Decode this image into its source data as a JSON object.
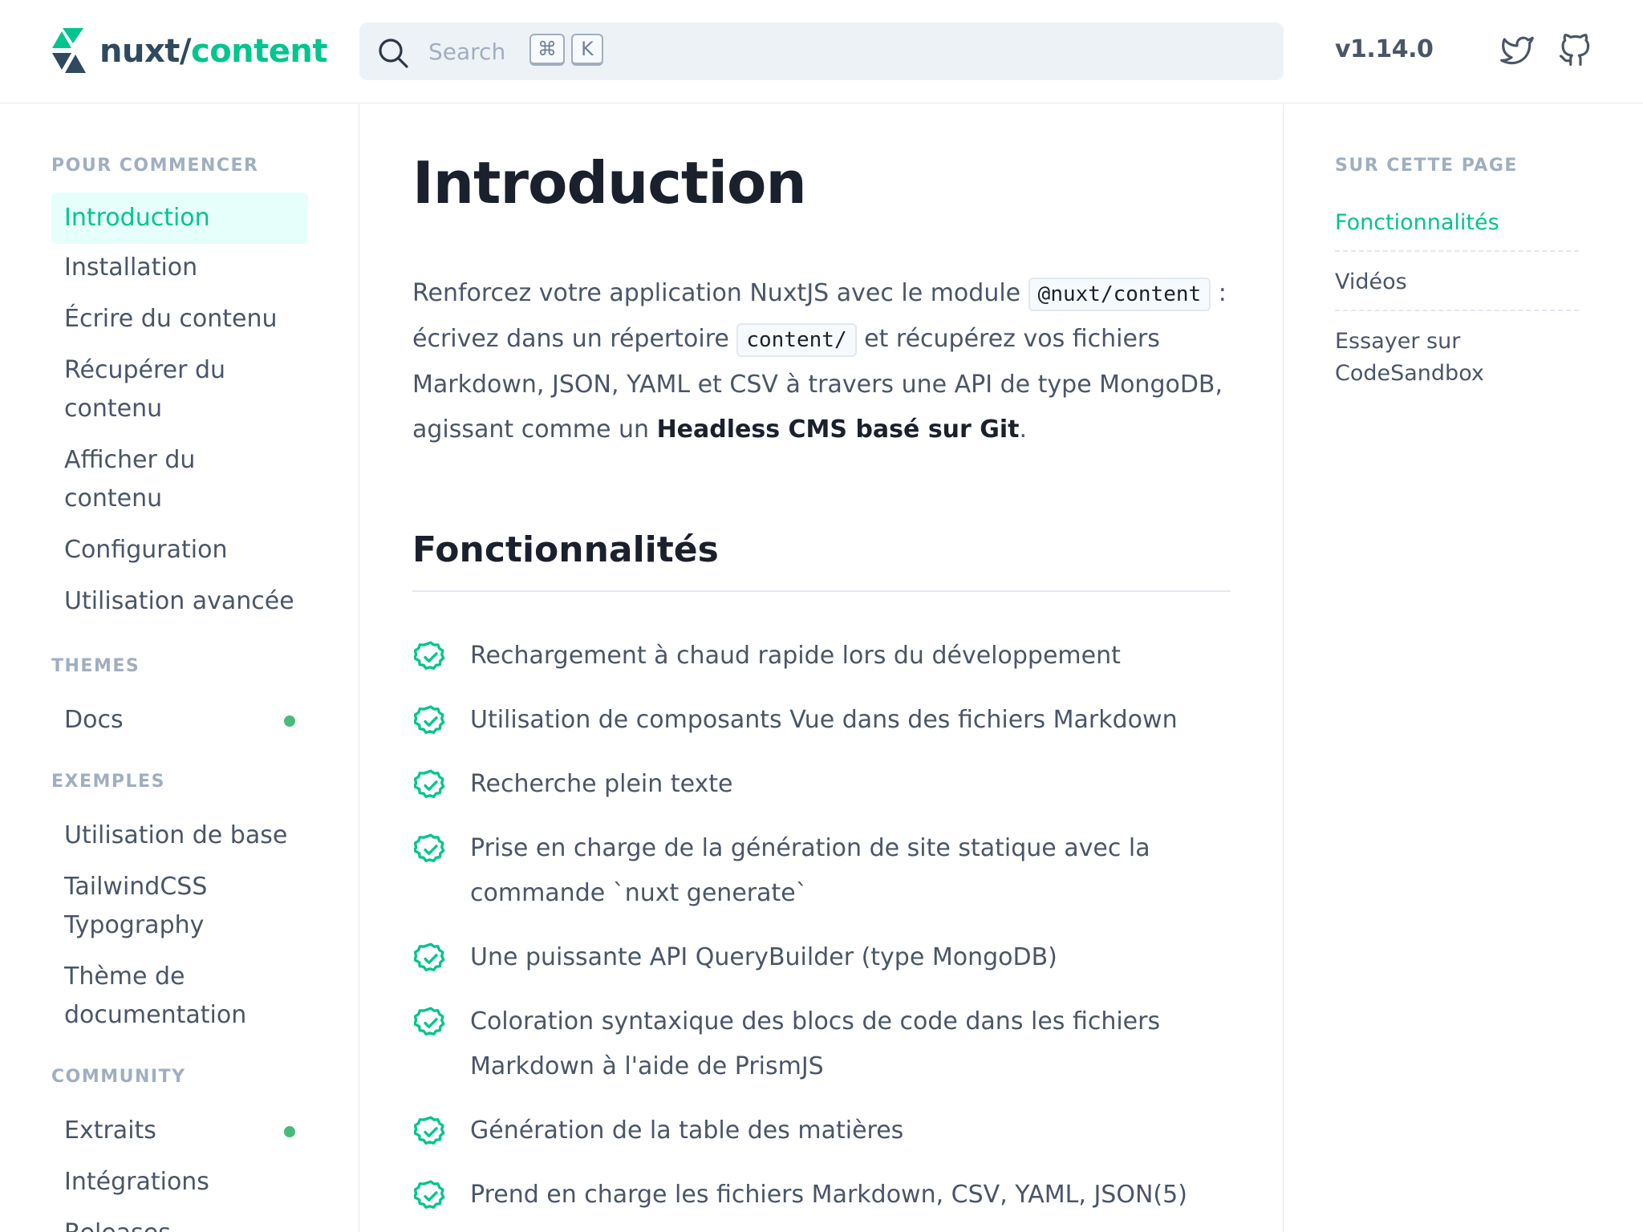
{
  "header": {
    "logo": {
      "part1": "nuxt/",
      "part2": "content"
    },
    "search": {
      "placeholder": "Search",
      "shortcut_keys": [
        "⌘",
        "K"
      ]
    },
    "version": "v1.14.0",
    "icons": [
      "twitter-icon",
      "github-icon"
    ]
  },
  "sidebar": {
    "sections": [
      {
        "title": "POUR COMMENCER",
        "items": [
          {
            "label": "Introduction",
            "active": true
          },
          {
            "label": "Installation"
          },
          {
            "label": "Écrire du contenu"
          },
          {
            "label": "Récupérer du contenu"
          },
          {
            "label": "Afficher du contenu"
          },
          {
            "label": "Configuration"
          },
          {
            "label": "Utilisation avancée"
          }
        ]
      },
      {
        "title": "THEMES",
        "items": [
          {
            "label": "Docs",
            "new_badge": true
          }
        ]
      },
      {
        "title": "EXEMPLES",
        "items": [
          {
            "label": "Utilisation de base"
          },
          {
            "label": "TailwindCSS Typography"
          },
          {
            "label": "Thème de documentation"
          }
        ]
      },
      {
        "title": "COMMUNITY",
        "items": [
          {
            "label": "Extraits",
            "new_badge": true
          },
          {
            "label": "Intégrations"
          },
          {
            "label": "Releases"
          }
        ]
      }
    ]
  },
  "main": {
    "title": "Introduction",
    "intro": {
      "text1": "Renforcez votre application NuxtJS avec le module ",
      "code1": "@nuxt/content",
      "text2": " : écrivez dans un répertoire ",
      "code2": "content/",
      "text3": " et récupérez vos fichiers Markdown, JSON, YAML et CSV à travers une API de type MongoDB, agissant comme un ",
      "strong": "Headless CMS basé sur Git",
      "text4": "."
    },
    "features_heading": "Fonctionnalités",
    "features": [
      "Rechargement à chaud rapide lors du développement",
      "Utilisation de composants Vue dans des fichiers Markdown",
      "Recherche plein texte",
      "Prise en charge de la génération de site statique avec la commande `nuxt generate`",
      "Une puissante API QueryBuilder (type MongoDB)",
      "Coloration syntaxique des blocs de code dans les fichiers Markdown à l'aide de PrismJS",
      "Génération de la table des matières",
      "Prend en charge les fichiers Markdown, CSV, YAML, JSON(5)"
    ]
  },
  "toc": {
    "title": "SUR CETTE PAGE",
    "items": [
      {
        "label": "Fonctionnalités",
        "active": true
      },
      {
        "label": "Vidéos"
      },
      {
        "label": "Essayer sur CodeSandbox"
      }
    ]
  },
  "colors": {
    "accent": "#00c58e",
    "active_bg": "#e6fffa",
    "badge": "#48bb78",
    "logo_dark": "#2f495e"
  }
}
